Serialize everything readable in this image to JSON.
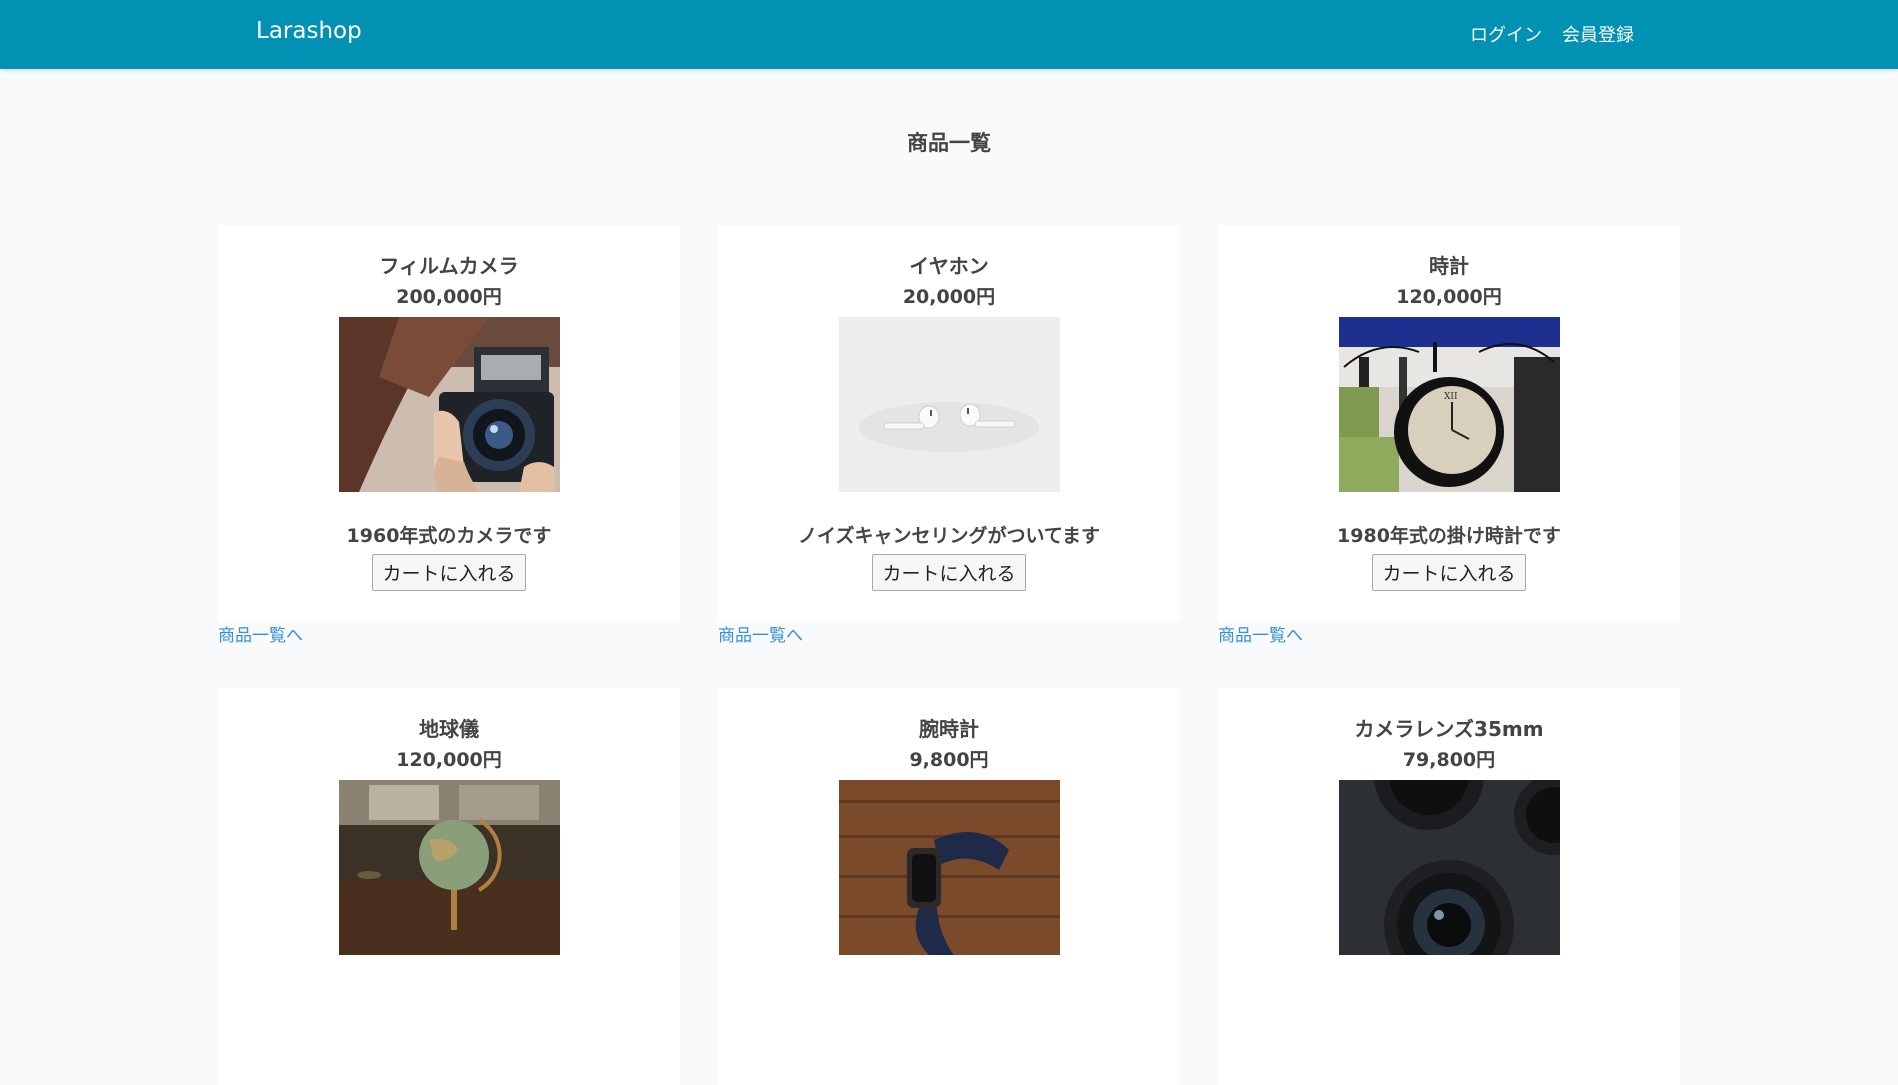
{
  "navbar": {
    "brand": "Larashop",
    "login": "ログイン",
    "register": "会員登録"
  },
  "page": {
    "title": "商品一覧"
  },
  "products": [
    {
      "name": "フィルムカメラ",
      "price": "200,000円",
      "description": "1960年式のカメラです",
      "cart_label": "カートに入れる",
      "back_link": "商品一覧へ",
      "image": "film-camera-photo"
    },
    {
      "name": "イヤホン",
      "price": "20,000円",
      "description": "ノイズキャンセリングがついてます",
      "cart_label": "カートに入れる",
      "back_link": "商品一覧へ",
      "image": "earphones-photo"
    },
    {
      "name": "時計",
      "price": "120,000円",
      "description": "1980年式の掛け時計です",
      "cart_label": "カートに入れる",
      "back_link": "商品一覧へ",
      "image": "hanging-clock-photo"
    },
    {
      "name": "地球儀",
      "price": "120,000円",
      "image": "globe-photo"
    },
    {
      "name": "腕時計",
      "price": "9,800円",
      "image": "wristwatch-photo"
    },
    {
      "name": "カメラレンズ35mm",
      "price": "79,800円",
      "image": "camera-lens-photo"
    }
  ]
}
